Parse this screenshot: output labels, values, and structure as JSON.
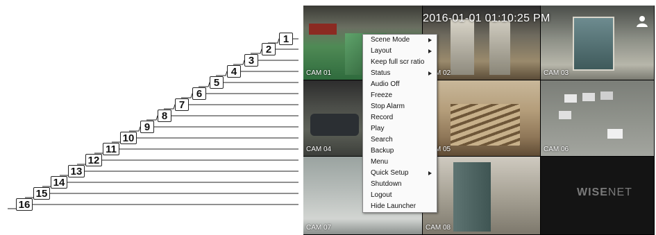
{
  "callouts": [
    "1",
    "2",
    "3",
    "4",
    "5",
    "6",
    "7",
    "8",
    "9",
    "10",
    "11",
    "12",
    "13",
    "14",
    "15",
    "16"
  ],
  "screen": {
    "clock": "2016-01-01 01:10:25 PM",
    "cameras": [
      "CAM 01",
      "CAM 02",
      "CAM 03",
      "CAM 04",
      "CAM 05",
      "CAM 06",
      "CAM 07",
      "CAM 08"
    ],
    "logo": {
      "bold": "WISE",
      "thin": "NET"
    },
    "user_icon": "user-icon"
  },
  "menu": {
    "items": [
      {
        "label": "Scene Mode",
        "submenu": true
      },
      {
        "label": "Layout",
        "submenu": true
      },
      {
        "label": "Keep full scr ratio",
        "submenu": false
      },
      {
        "label": "Status",
        "submenu": true
      },
      {
        "label": "Audio Off",
        "submenu": false
      },
      {
        "label": "Freeze",
        "submenu": false
      },
      {
        "label": "Stop Alarm",
        "submenu": false
      },
      {
        "label": "Record",
        "submenu": false
      },
      {
        "label": "Play",
        "submenu": false
      },
      {
        "label": "Search",
        "submenu": false
      },
      {
        "label": "Backup",
        "submenu": false
      },
      {
        "label": "Menu",
        "submenu": false
      },
      {
        "label": "Quick Setup",
        "submenu": true
      },
      {
        "label": "Shutdown",
        "submenu": false
      },
      {
        "label": "Logout",
        "submenu": false
      },
      {
        "label": "Hide Launcher",
        "submenu": false
      }
    ]
  }
}
